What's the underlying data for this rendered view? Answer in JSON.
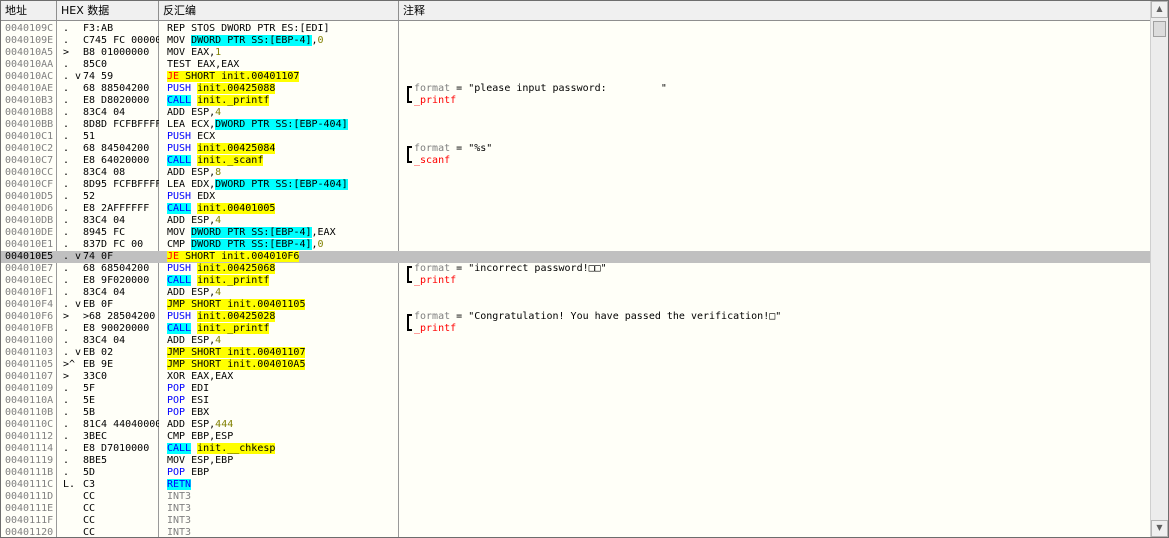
{
  "columns": {
    "address": "地址",
    "hex": "HEX 数据",
    "disasm": "反汇编",
    "comment": "注释"
  },
  "rows": [
    {
      "addr": "0040109C",
      "mark": ".",
      "hex": "F3:AB",
      "dis": [
        [
          "REP STOS DWORD PTR ES:[EDI]",
          ""
        ]
      ],
      "cmt": null
    },
    {
      "addr": "0040109E",
      "mark": ".",
      "hex": "C745 FC 00000",
      "dis": [
        [
          "MOV ",
          ""
        ],
        [
          "DWORD PTR SS:[EBP-4]",
          "hl-c"
        ],
        [
          ",",
          ""
        ],
        [
          "0",
          "num-olive"
        ]
      ],
      "cmt": null
    },
    {
      "addr": "004010A5",
      "mark": ">",
      "hex": "B8 01000000",
      "dis": [
        [
          "MOV EAX,",
          ""
        ],
        [
          "1",
          "num-olive"
        ]
      ],
      "cmt": null
    },
    {
      "addr": "004010AA",
      "mark": ".",
      "hex": "85C0",
      "dis": [
        [
          "TEST EAX,EAX",
          ""
        ]
      ],
      "cmt": null
    },
    {
      "addr": "004010AC",
      "mark": ". v",
      "hex": "74 59",
      "dis": [
        [
          "JE",
          "hl-y kw-red"
        ],
        [
          " SHORT init.00401107",
          "hl-y"
        ]
      ],
      "cmt": null
    },
    {
      "addr": "004010AE",
      "mark": ".",
      "hex": "68 88504200",
      "dis": [
        [
          "PUSH",
          "kw-blue"
        ],
        [
          " ",
          ""
        ],
        [
          "init.00425088",
          "hl-y"
        ]
      ],
      "cmt": {
        "type": "arg",
        "label": "format",
        "value": "= \"please input password:         \""
      }
    },
    {
      "addr": "004010B3",
      "mark": ".",
      "hex": "E8 D8020000",
      "dis": [
        [
          "CALL",
          "hl-c kw-blue"
        ],
        [
          " ",
          ""
        ],
        [
          "init._printf",
          "hl-y"
        ]
      ],
      "cmt": {
        "type": "call",
        "name": "_printf"
      }
    },
    {
      "addr": "004010B8",
      "mark": ".",
      "hex": "83C4 04",
      "dis": [
        [
          "ADD ESP,",
          ""
        ],
        [
          "4",
          "num-olive"
        ]
      ],
      "cmt": null
    },
    {
      "addr": "004010BB",
      "mark": ".",
      "hex": "8D8D FCFBFFFF",
      "dis": [
        [
          "LEA ECX,",
          ""
        ],
        [
          "DWORD PTR SS:[EBP-404]",
          "hl-c"
        ]
      ],
      "cmt": null
    },
    {
      "addr": "004010C1",
      "mark": ".",
      "hex": "51",
      "dis": [
        [
          "PUSH",
          "kw-blue"
        ],
        [
          " ECX",
          ""
        ]
      ],
      "cmt": null
    },
    {
      "addr": "004010C2",
      "mark": ".",
      "hex": "68 84504200",
      "dis": [
        [
          "PUSH",
          "kw-blue"
        ],
        [
          " ",
          ""
        ],
        [
          "init.00425084",
          "hl-y"
        ]
      ],
      "cmt": {
        "type": "arg",
        "label": "format",
        "value": "= \"%s\""
      }
    },
    {
      "addr": "004010C7",
      "mark": ".",
      "hex": "E8 64020000",
      "dis": [
        [
          "CALL",
          "hl-c kw-blue"
        ],
        [
          " ",
          ""
        ],
        [
          "init._scanf",
          "hl-y"
        ]
      ],
      "cmt": {
        "type": "call",
        "name": "_scanf"
      }
    },
    {
      "addr": "004010CC",
      "mark": ".",
      "hex": "83C4 08",
      "dis": [
        [
          "ADD ESP,",
          ""
        ],
        [
          "8",
          "num-olive"
        ]
      ],
      "cmt": null
    },
    {
      "addr": "004010CF",
      "mark": ".",
      "hex": "8D95 FCFBFFFF",
      "dis": [
        [
          "LEA EDX,",
          ""
        ],
        [
          "DWORD PTR SS:[EBP-404]",
          "hl-c"
        ]
      ],
      "cmt": null
    },
    {
      "addr": "004010D5",
      "mark": ".",
      "hex": "52",
      "dis": [
        [
          "PUSH",
          "kw-blue"
        ],
        [
          " EDX",
          ""
        ]
      ],
      "cmt": null
    },
    {
      "addr": "004010D6",
      "mark": ".",
      "hex": "E8 2AFFFFFF",
      "dis": [
        [
          "CALL",
          "hl-c kw-blue"
        ],
        [
          " ",
          ""
        ],
        [
          "init.00401005",
          "hl-y"
        ]
      ],
      "cmt": null
    },
    {
      "addr": "004010DB",
      "mark": ".",
      "hex": "83C4 04",
      "dis": [
        [
          "ADD ESP,",
          ""
        ],
        [
          "4",
          "num-olive"
        ]
      ],
      "cmt": null
    },
    {
      "addr": "004010DE",
      "mark": ".",
      "hex": "8945 FC",
      "dis": [
        [
          "MOV ",
          ""
        ],
        [
          "DWORD PTR SS:[EBP-4]",
          "hl-c"
        ],
        [
          ",EAX",
          ""
        ]
      ],
      "cmt": null
    },
    {
      "addr": "004010E1",
      "mark": ".",
      "hex": "837D FC 00",
      "dis": [
        [
          "CMP ",
          ""
        ],
        [
          "DWORD PTR SS:[EBP-4]",
          "hl-c"
        ],
        [
          ",",
          ""
        ],
        [
          "0",
          "num-olive"
        ]
      ],
      "cmt": null
    },
    {
      "addr": "004010E5",
      "mark": ". v",
      "hex": "74 0F",
      "dis": [
        [
          "JE",
          "hl-y kw-red"
        ],
        [
          " SHORT init.004010F6",
          "hl-y"
        ]
      ],
      "cmt": null,
      "selected": true
    },
    {
      "addr": "004010E7",
      "mark": ".",
      "hex": "68 68504200",
      "dis": [
        [
          "PUSH",
          "kw-blue"
        ],
        [
          " ",
          ""
        ],
        [
          "init.00425068",
          "hl-y"
        ]
      ],
      "cmt": {
        "type": "arg",
        "label": "format",
        "value": "= \"incorrect password!□□\""
      }
    },
    {
      "addr": "004010EC",
      "mark": ".",
      "hex": "E8 9F020000",
      "dis": [
        [
          "CALL",
          "hl-c kw-blue"
        ],
        [
          " ",
          ""
        ],
        [
          "init._printf",
          "hl-y"
        ]
      ],
      "cmt": {
        "type": "call",
        "name": "_printf"
      }
    },
    {
      "addr": "004010F1",
      "mark": ".",
      "hex": "83C4 04",
      "dis": [
        [
          "ADD ESP,",
          ""
        ],
        [
          "4",
          "num-olive"
        ]
      ],
      "cmt": null
    },
    {
      "addr": "004010F4",
      "mark": ". v",
      "hex": "EB 0F",
      "dis": [
        [
          "JMP SHORT init.00401105",
          "hl-y"
        ]
      ],
      "cmt": null
    },
    {
      "addr": "004010F6",
      "mark": ">",
      "hex": ">68 28504200",
      "dis": [
        [
          "PUSH",
          "kw-blue"
        ],
        [
          " ",
          ""
        ],
        [
          "init.00425028",
          "hl-y"
        ]
      ],
      "cmt": {
        "type": "arg",
        "label": "format",
        "value": "= \"Congratulation! You have passed the verification!□\""
      }
    },
    {
      "addr": "004010FB",
      "mark": ".",
      "hex": "E8 90020000",
      "dis": [
        [
          "CALL",
          "hl-c kw-blue"
        ],
        [
          " ",
          ""
        ],
        [
          "init._printf",
          "hl-y"
        ]
      ],
      "cmt": {
        "type": "call",
        "name": "_printf"
      }
    },
    {
      "addr": "00401100",
      "mark": ".",
      "hex": "83C4 04",
      "dis": [
        [
          "ADD ESP,",
          ""
        ],
        [
          "4",
          "num-olive"
        ]
      ],
      "cmt": null
    },
    {
      "addr": "00401103",
      "mark": ". v",
      "hex": "EB 02",
      "dis": [
        [
          "JMP SHORT init.00401107",
          "hl-y"
        ]
      ],
      "cmt": null
    },
    {
      "addr": "00401105",
      "mark": ">^",
      "hex": "EB 9E",
      "dis": [
        [
          "JMP SHORT init.004010A5",
          "hl-y"
        ]
      ],
      "cmt": null
    },
    {
      "addr": "00401107",
      "mark": ">",
      "hex": "33C0",
      "dis": [
        [
          "XOR EAX,EAX",
          ""
        ]
      ],
      "cmt": null
    },
    {
      "addr": "00401109",
      "mark": ".",
      "hex": "5F",
      "dis": [
        [
          "POP",
          "kw-blue"
        ],
        [
          " EDI",
          ""
        ]
      ],
      "cmt": null
    },
    {
      "addr": "0040110A",
      "mark": ".",
      "hex": "5E",
      "dis": [
        [
          "POP",
          "kw-blue"
        ],
        [
          " ESI",
          ""
        ]
      ],
      "cmt": null
    },
    {
      "addr": "0040110B",
      "mark": ".",
      "hex": "5B",
      "dis": [
        [
          "POP",
          "kw-blue"
        ],
        [
          " EBX",
          ""
        ]
      ],
      "cmt": null
    },
    {
      "addr": "0040110C",
      "mark": ".",
      "hex": "81C4 44040000",
      "dis": [
        [
          "ADD ESP,",
          ""
        ],
        [
          "444",
          "num-olive"
        ]
      ],
      "cmt": null
    },
    {
      "addr": "00401112",
      "mark": ".",
      "hex": "3BEC",
      "dis": [
        [
          "CMP EBP,ESP",
          ""
        ]
      ],
      "cmt": null
    },
    {
      "addr": "00401114",
      "mark": ".",
      "hex": "E8 D7010000",
      "dis": [
        [
          "CALL",
          "hl-c kw-blue"
        ],
        [
          " ",
          ""
        ],
        [
          "init.__chkesp",
          "hl-y"
        ]
      ],
      "cmt": null
    },
    {
      "addr": "00401119",
      "mark": ".",
      "hex": "8BE5",
      "dis": [
        [
          "MOV ESP,EBP",
          ""
        ]
      ],
      "cmt": null
    },
    {
      "addr": "0040111B",
      "mark": ".",
      "hex": "5D",
      "dis": [
        [
          "POP",
          "kw-blue"
        ],
        [
          " EBP",
          ""
        ]
      ],
      "cmt": null
    },
    {
      "addr": "0040111C",
      "mark": "L.",
      "hex": "C3",
      "dis": [
        [
          "RETN",
          "hl-c kw-blue"
        ]
      ],
      "cmt": null
    },
    {
      "addr": "0040111D",
      "mark": "",
      "hex": "CC",
      "dis": [
        [
          "INT3",
          "gray"
        ]
      ],
      "cmt": null
    },
    {
      "addr": "0040111E",
      "mark": "",
      "hex": "CC",
      "dis": [
        [
          "INT3",
          "gray"
        ]
      ],
      "cmt": null
    },
    {
      "addr": "0040111F",
      "mark": "",
      "hex": "CC",
      "dis": [
        [
          "INT3",
          "gray"
        ]
      ],
      "cmt": null
    },
    {
      "addr": "00401120",
      "mark": "",
      "hex": "CC",
      "dis": [
        [
          "INT3",
          "gray"
        ]
      ],
      "cmt": null
    }
  ],
  "scrollbar": {
    "up_icon": "▲",
    "down_icon": "▼"
  }
}
